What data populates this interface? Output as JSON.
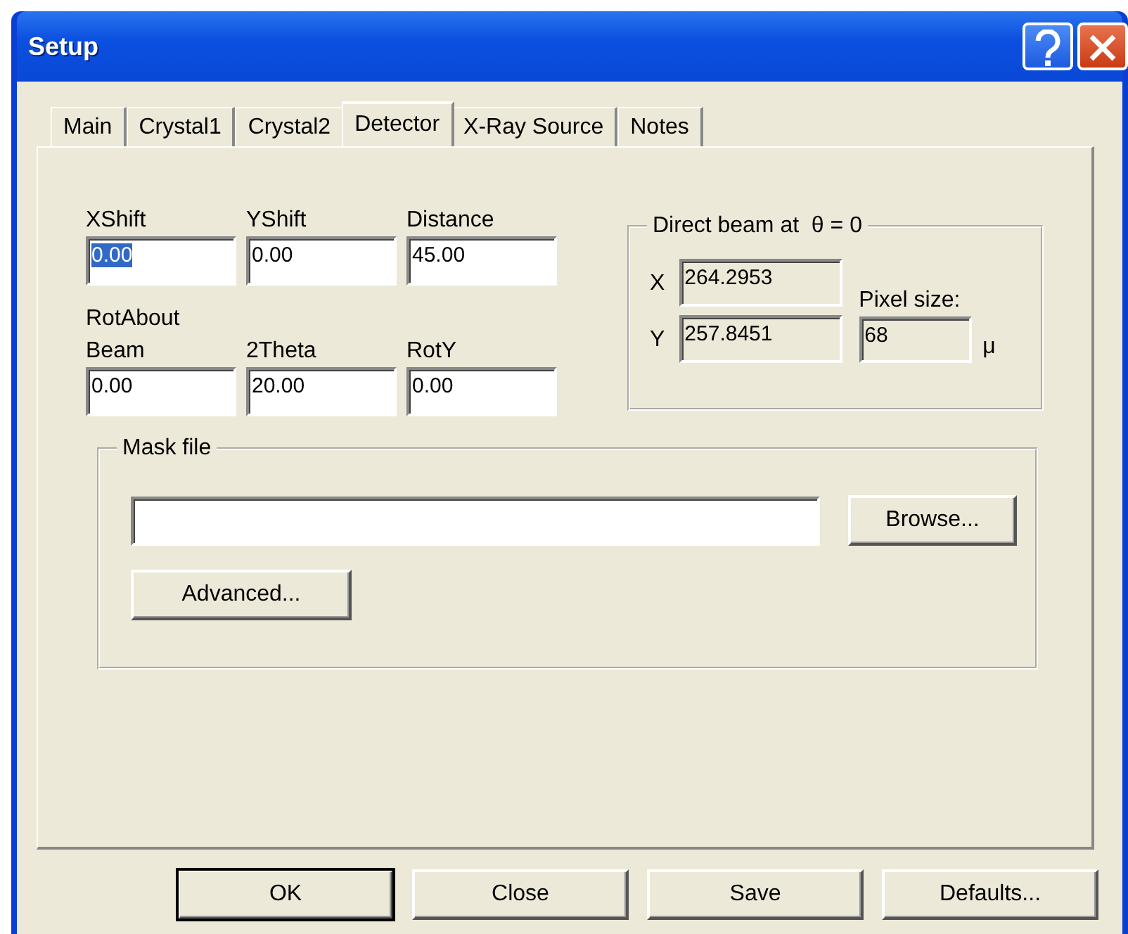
{
  "window": {
    "title": "Setup"
  },
  "tabs": [
    {
      "label": "Main",
      "selected": false
    },
    {
      "label": "Crystal1",
      "selected": false
    },
    {
      "label": "Crystal2",
      "selected": false
    },
    {
      "label": "Detector",
      "selected": true
    },
    {
      "label": "X-Ray Source",
      "selected": false
    },
    {
      "label": "Notes",
      "selected": false
    }
  ],
  "geometry_rows": [
    [
      {
        "label": "XShift",
        "value": "0.00",
        "selected": true
      },
      {
        "label": "YShift",
        "value": "0.00",
        "selected": false
      },
      {
        "label": "Distance",
        "value": "45.00",
        "selected": false
      }
    ],
    [
      {
        "label": "RotAbout\nBeam",
        "value": "0.00",
        "selected": false
      },
      {
        "label": "2Theta",
        "value": "20.00",
        "selected": false
      },
      {
        "label": "RotY",
        "value": "0.00",
        "selected": false
      }
    ]
  ],
  "direct_beam": {
    "title": "Direct beam at  θ = 0",
    "x_label": "X",
    "x_value": "264.2953",
    "y_label": "Y",
    "y_value": "257.8451",
    "pixel_size_label": "Pixel size:",
    "pixel_size_value": "68",
    "pixel_unit": "μ"
  },
  "mask_file": {
    "title": "Mask file",
    "browse": "Browse...",
    "advanced": "Advanced..."
  },
  "buttons": [
    {
      "label": "OK",
      "default": true
    },
    {
      "label": "Close",
      "default": false
    },
    {
      "label": "Save",
      "default": false
    },
    {
      "label": "Defaults...",
      "default": false
    }
  ]
}
